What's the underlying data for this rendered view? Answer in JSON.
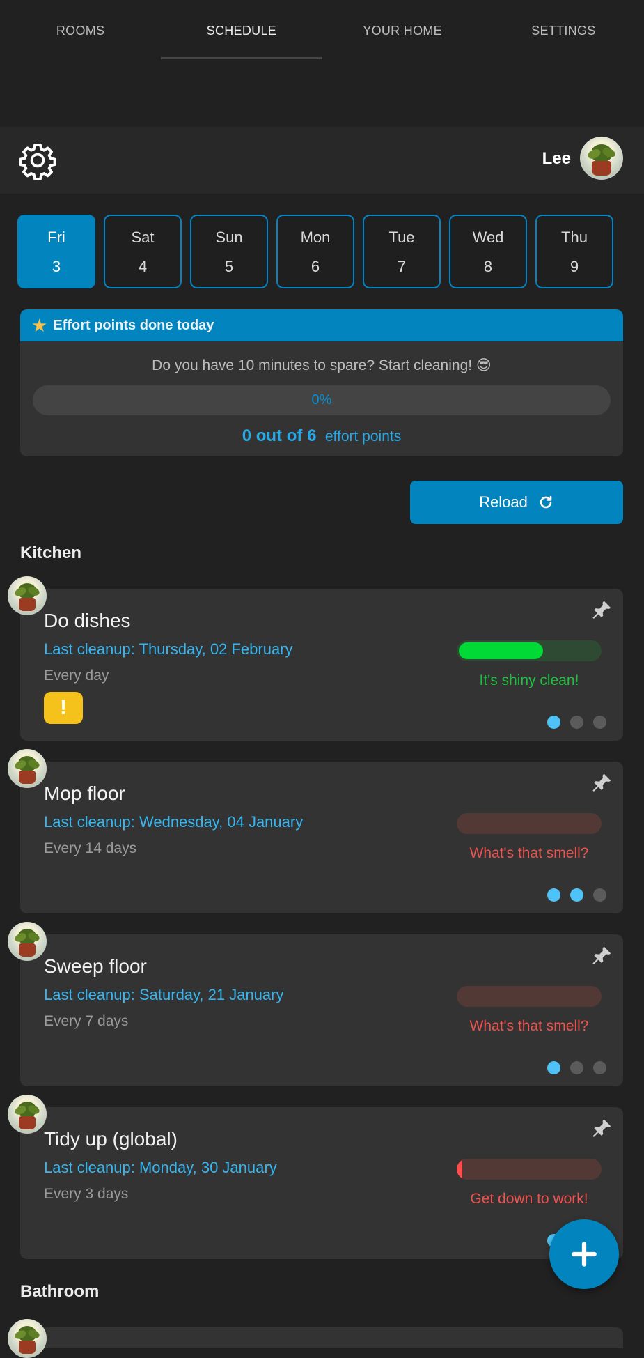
{
  "tabs": [
    {
      "label": "ROOMS"
    },
    {
      "label": "SCHEDULE"
    },
    {
      "label": "YOUR HOME"
    },
    {
      "label": "SETTINGS"
    }
  ],
  "header": {
    "username": "Lee"
  },
  "days": [
    {
      "name": "Fri",
      "num": "3"
    },
    {
      "name": "Sat",
      "num": "4"
    },
    {
      "name": "Sun",
      "num": "5"
    },
    {
      "name": "Mon",
      "num": "6"
    },
    {
      "name": "Tue",
      "num": "7"
    },
    {
      "name": "Wed",
      "num": "8"
    },
    {
      "name": "Thu",
      "num": "9"
    }
  ],
  "effort": {
    "title": "Effort points done today",
    "message": "Do you have 10 minutes to spare? Start cleaning! 😎",
    "percent_label": "0%",
    "percent_value": 0,
    "points_done": "0 out of 6",
    "points_label": "effort points"
  },
  "reload": {
    "label": "Reload"
  },
  "sections": [
    {
      "title": "Kitchen",
      "tasks": [
        {
          "name": "Do dishes",
          "last": "Last cleanup: Thursday, 02 February",
          "freq": "Every day",
          "status": "It's shiny clean!",
          "status_color": "#22c042",
          "bar_bg": "#2f4a33",
          "bar_fill": "#00d936",
          "bar_level": 0.58,
          "warning": "!",
          "dots": [
            true,
            false,
            false
          ]
        },
        {
          "name": "Mop floor",
          "last": "Last cleanup: Wednesday, 04 January",
          "freq": "Every 14 days",
          "status": "What's that smell?",
          "status_color": "#ef5350",
          "bar_bg": "#523936",
          "bar_fill": "#ef5350",
          "bar_level": 0,
          "dots": [
            true,
            true,
            false
          ]
        },
        {
          "name": "Sweep floor",
          "last": "Last cleanup: Saturday, 21 January",
          "freq": "Every 7 days",
          "status": "What's that smell?",
          "status_color": "#ef5350",
          "bar_bg": "#523936",
          "bar_fill": "#ef5350",
          "bar_level": 0,
          "dots": [
            true,
            false,
            false
          ]
        },
        {
          "name": "Tidy up (global)",
          "last": "Last cleanup: Monday, 30 January",
          "freq": "Every 3 days",
          "status": "Get down to work!",
          "status_color": "#ef5350",
          "bar_bg": "#523936",
          "bar_fill": "#ff4d4d",
          "bar_level": 0.03,
          "dots": [
            true,
            false,
            false
          ]
        }
      ]
    },
    {
      "title": "Bathroom",
      "tasks": []
    }
  ],
  "colors": {
    "accent": "#0284be",
    "link": "#37b5ee",
    "background": "#212121",
    "card": "#333333"
  },
  "icons": {
    "settings": "gear-icon",
    "pin": "pin-icon",
    "reload": "reload-icon",
    "add": "plus-icon",
    "star": "star-icon"
  }
}
